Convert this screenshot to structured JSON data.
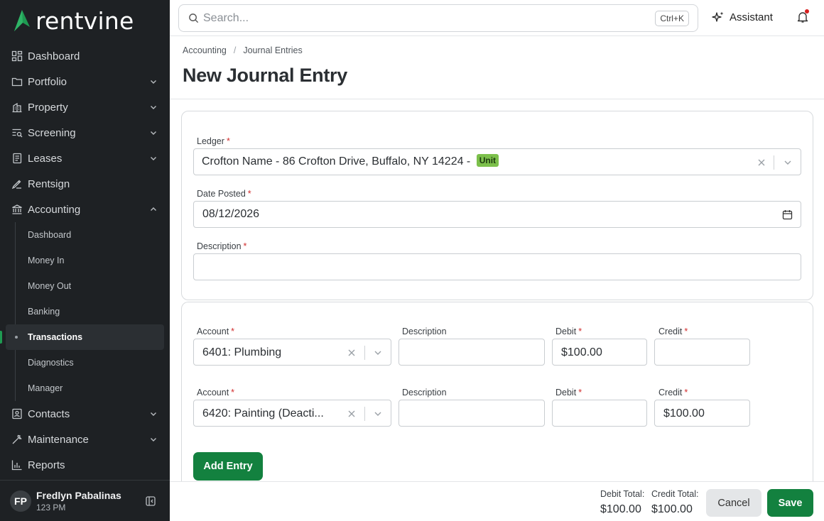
{
  "brand": {
    "name": "rentvine",
    "accent": "#13813f"
  },
  "sidebar": {
    "items": [
      {
        "label": "Dashboard",
        "icon": "dashboard-icon"
      },
      {
        "label": "Portfolio",
        "icon": "folder-icon",
        "expandable": true
      },
      {
        "label": "Property",
        "icon": "building-icon",
        "expandable": true
      },
      {
        "label": "Screening",
        "icon": "screening-icon",
        "expandable": true
      },
      {
        "label": "Leases",
        "icon": "document-icon",
        "expandable": true
      },
      {
        "label": "Rentsign",
        "icon": "signature-icon"
      },
      {
        "label": "Accounting",
        "icon": "bank-icon",
        "expandable": true,
        "expanded": true
      }
    ],
    "accounting_sub": [
      {
        "label": "Dashboard"
      },
      {
        "label": "Money In"
      },
      {
        "label": "Money Out"
      },
      {
        "label": "Banking"
      },
      {
        "label": "Transactions",
        "active": true
      },
      {
        "label": "Diagnostics"
      },
      {
        "label": "Manager"
      }
    ],
    "items_after": [
      {
        "label": "Contacts",
        "icon": "contacts-icon",
        "expandable": true
      },
      {
        "label": "Maintenance",
        "icon": "wrench-icon",
        "expandable": true
      },
      {
        "label": "Reports",
        "icon": "chart-icon"
      }
    ],
    "user": {
      "initials": "FP",
      "name": "Fredlyn Pabalinas",
      "org": "123 PM"
    }
  },
  "topbar": {
    "search_placeholder": "Search...",
    "shortcut": "Ctrl+K",
    "assistant_label": "Assistant"
  },
  "header": {
    "breadcrumb": [
      "Accounting",
      "Journal Entries"
    ],
    "title": "New Journal Entry"
  },
  "form": {
    "ledger_label": "Ledger",
    "ledger_value": "Crofton Name - 86 Crofton Drive, Buffalo, NY 14224 -",
    "ledger_badge": "Unit",
    "date_label": "Date Posted",
    "date_value": "08/12/2026",
    "description_label": "Description",
    "description_value": ""
  },
  "entries": {
    "labels": {
      "account": "Account",
      "description": "Description",
      "debit": "Debit",
      "credit": "Credit"
    },
    "rows": [
      {
        "account": "6401: Plumbing",
        "description": "",
        "debit": "$100.00",
        "credit": ""
      },
      {
        "account": "6420: Painting (Deacti...",
        "description": "",
        "debit": "",
        "credit": "$100.00"
      }
    ],
    "add_label": "Add Entry"
  },
  "footer": {
    "debit_total_label": "Debit Total:",
    "debit_total": "$100.00",
    "credit_total_label": "Credit Total:",
    "credit_total": "$100.00",
    "cancel_label": "Cancel",
    "save_label": "Save"
  }
}
